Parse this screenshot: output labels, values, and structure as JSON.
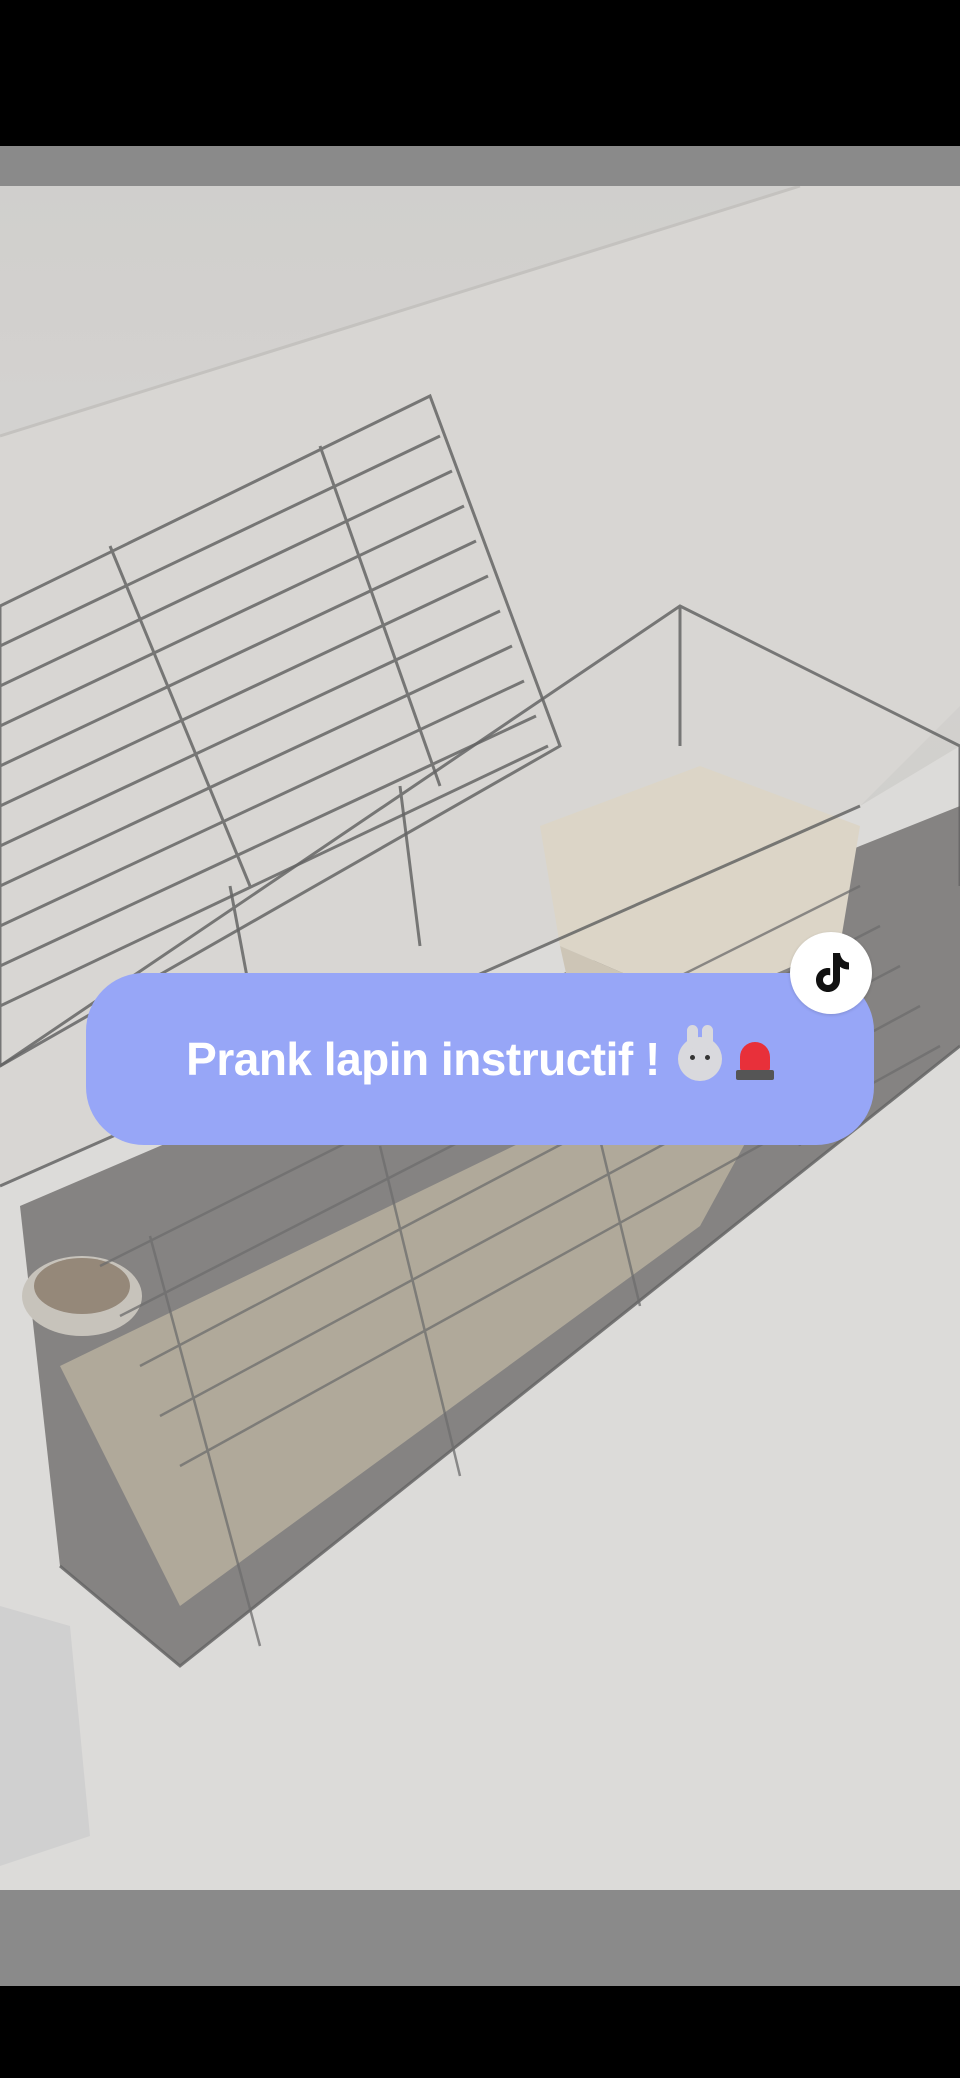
{
  "caption": {
    "text": "Prank lapin instructif !",
    "emojis": [
      "rabbit-face",
      "police-car-light"
    ],
    "bubble_color": "#97a6f7",
    "text_color": "#ffffff"
  },
  "badge": {
    "icon": "tiktok-logo-icon"
  },
  "photo": {
    "subject": "empty-rabbit-cage-with-open-lid",
    "letterbox_color": "#8a8a8a"
  }
}
